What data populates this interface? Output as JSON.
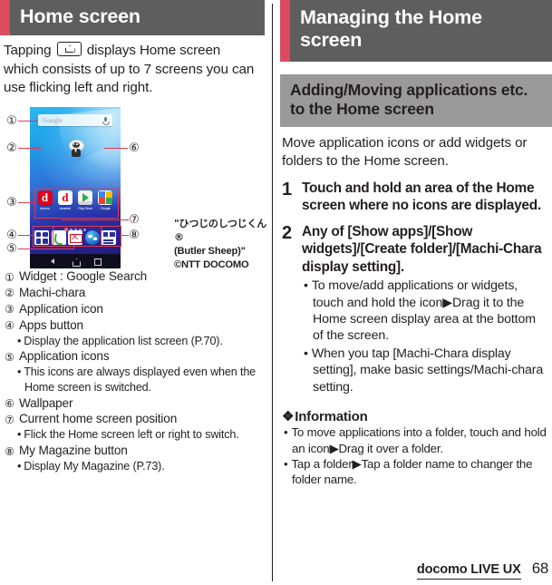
{
  "left": {
    "title": "Home screen",
    "lead_before": "Tapping",
    "lead_after": "displays Home screen which consists of up to 7 screens you can use flicking left and right.",
    "home_key_icon": "home-key-icon",
    "phone": {
      "search_widget_text": "Google",
      "mic_icon": "microphone-icon",
      "apps": [
        {
          "label": "dmenu",
          "icon": "dmenu-icon"
        },
        {
          "label": "dmarket",
          "icon": "dmarket-icon"
        },
        {
          "label": "Play Store",
          "icon": "play-store-icon"
        },
        {
          "label": "Google",
          "icon": "google-folder-icon"
        }
      ],
      "dock": [
        {
          "name": "apps-button",
          "icon": "apps-grid-icon"
        },
        {
          "name": "phone",
          "icon": "phone-icon"
        },
        {
          "name": "mail",
          "icon": "mail-icon"
        },
        {
          "name": "browser",
          "icon": "browser-icon"
        },
        {
          "name": "my-magazine-button",
          "icon": "my-magazine-icon"
        }
      ],
      "page_dots_total": 5,
      "page_dots_active": 1,
      "nav": [
        "back-icon",
        "home-icon",
        "recents-icon"
      ]
    },
    "copyright": {
      "line1": "\"ひつじのしつじくん®",
      "line2": "(Butler Sheep)\"",
      "line3": "©NTT DOCOMO"
    },
    "legend": [
      {
        "mark": "①",
        "text": "Widget : Google Search",
        "subs": []
      },
      {
        "mark": "②",
        "text": "Machi-chara",
        "subs": []
      },
      {
        "mark": "③",
        "text": "Application icon",
        "subs": []
      },
      {
        "mark": "④",
        "text": "Apps button",
        "subs": [
          "Display the application list screen (P.70)."
        ]
      },
      {
        "mark": "⑤",
        "text": "Application icons",
        "subs": [
          "This icons are always displayed even when the Home screen is switched."
        ]
      },
      {
        "mark": "⑥",
        "text": "Wallpaper",
        "subs": []
      },
      {
        "mark": "⑦",
        "text": "Current home screen position",
        "subs": [
          "Flick the Home screen left or right to switch."
        ]
      },
      {
        "mark": "⑧",
        "text": "My Magazine button",
        "subs": [
          "Display My Magazine (P.73)."
        ]
      }
    ],
    "callout_marks": [
      "①",
      "②",
      "③",
      "④",
      "⑤",
      "⑥",
      "⑦",
      "⑧"
    ]
  },
  "right": {
    "title": "Managing the Home screen",
    "section": "Adding/Moving applications etc. to the Home screen",
    "lead": "Move application icons or add widgets or folders to the Home screen.",
    "steps": [
      {
        "num": "1",
        "text": "Touch and hold an area of the Home screen where no icons are displayed.",
        "bullets": []
      },
      {
        "num": "2",
        "text": "Any of [Show apps]/[Show widgets]/[Create folder]/[Machi-Chara display setting].",
        "bullets": [
          "To move/add applications or widgets, touch and hold the icon▶Drag it to the Home screen display area at the bottom of the screen.",
          "When you tap [Machi-Chara display setting], make basic settings/Machi-chara setting."
        ]
      }
    ],
    "info_heading": "Information",
    "info_diamond": "❖",
    "info_items": [
      "To move applications into a folder, touch and hold an icon▶Drag it over a folder.",
      "Tap a folder▶Tap a folder name to changer the folder name."
    ]
  },
  "footer": {
    "brand": "docomo LIVE UX",
    "page": "68"
  },
  "colors": {
    "accent_red": "#dc4a5d",
    "title_gray": "#5e5e5e",
    "band_gray": "#9a9a9a",
    "callout_red": "#e03a50",
    "text": "#231f20"
  }
}
